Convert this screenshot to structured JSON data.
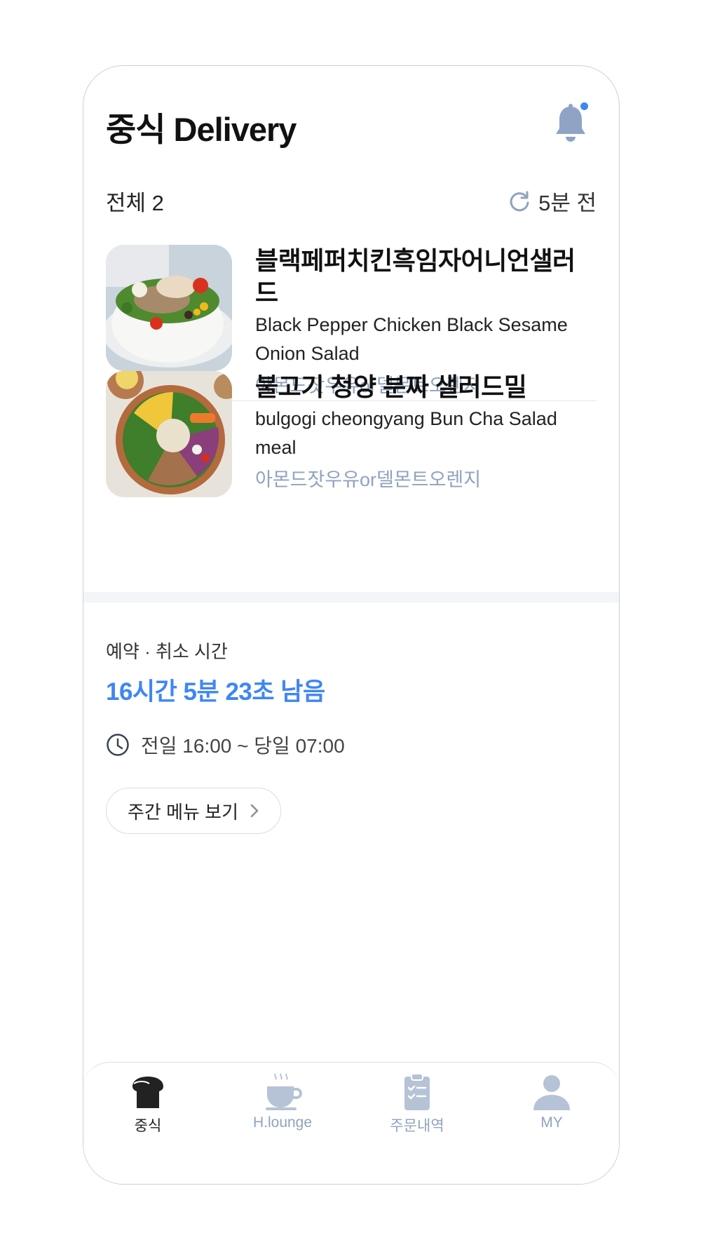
{
  "header": {
    "title": "중식 Delivery"
  },
  "summary": {
    "total": "전체 2",
    "refreshed": "5분 전"
  },
  "menu_items": [
    {
      "name_ko": "블랙페퍼치킨흑임자어니언샐러드",
      "name_en": "Black Pepper Chicken Black Sesame Onion Salad",
      "option": "아몬드잣우유or델몬트오렌지"
    },
    {
      "name_ko": "불고기 청양 분짜 샐러드밀",
      "name_en": "bulgogi cheongyang Bun Cha Salad meal",
      "option": "아몬드잣우유or델몬트오렌지"
    }
  ],
  "reservation": {
    "label": "예약 · 취소 시간",
    "countdown": "16시간 5분 23초 남음",
    "time_range": "전일 16:00 ~ 당일 07:00"
  },
  "weekly_button": {
    "label": "주간 메뉴 보기"
  },
  "tabs": [
    {
      "label": "중식",
      "icon": "bread-icon",
      "active": true
    },
    {
      "label": "H.lounge",
      "icon": "coffee-cup-icon",
      "active": false
    },
    {
      "label": "주문내역",
      "icon": "clipboard-icon",
      "active": false
    },
    {
      "label": "MY",
      "icon": "person-icon",
      "active": false
    }
  ],
  "colors": {
    "accent": "#3f86f5",
    "muted": "#8fa3bf",
    "text": "#111111"
  }
}
